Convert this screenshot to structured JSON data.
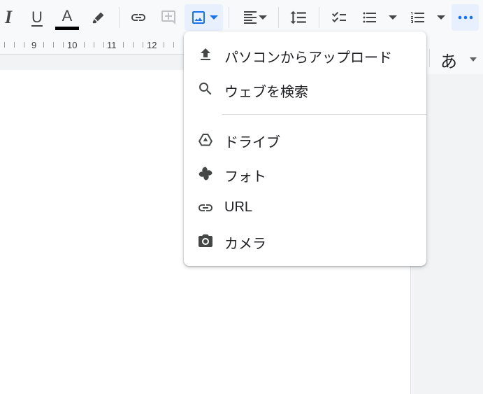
{
  "toolbar": {
    "italic": "I",
    "underline": "U",
    "text_color": "A",
    "text_color_swatch": "#000000",
    "accent": "#1a73e8"
  },
  "ruler": {
    "numbers": [
      "9",
      "10",
      "11",
      "12"
    ]
  },
  "input_tool": {
    "glyph": "あ"
  },
  "menu": {
    "items": [
      {
        "label": "パソコンからアップロード",
        "icon": "upload-icon"
      },
      {
        "label": "ウェブを検索",
        "icon": "search-icon"
      },
      {
        "label": "ドライブ",
        "icon": "drive-icon"
      },
      {
        "label": "フォト",
        "icon": "photos-icon"
      },
      {
        "label": "URL",
        "icon": "link-icon"
      },
      {
        "label": "カメラ",
        "icon": "camera-icon"
      }
    ]
  }
}
